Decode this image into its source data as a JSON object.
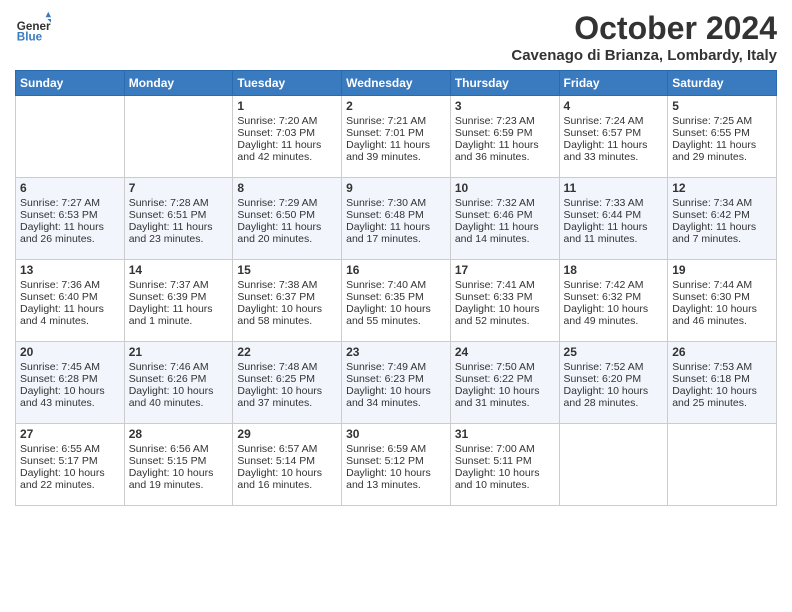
{
  "header": {
    "logo_line1": "General",
    "logo_line2": "Blue",
    "month": "October 2024",
    "location": "Cavenago di Brianza, Lombardy, Italy"
  },
  "weekdays": [
    "Sunday",
    "Monday",
    "Tuesday",
    "Wednesday",
    "Thursday",
    "Friday",
    "Saturday"
  ],
  "weeks": [
    [
      {
        "day": "",
        "empty": true
      },
      {
        "day": "",
        "empty": true
      },
      {
        "day": "1",
        "sunrise": "Sunrise: 7:20 AM",
        "sunset": "Sunset: 7:03 PM",
        "daylight": "Daylight: 11 hours and 42 minutes."
      },
      {
        "day": "2",
        "sunrise": "Sunrise: 7:21 AM",
        "sunset": "Sunset: 7:01 PM",
        "daylight": "Daylight: 11 hours and 39 minutes."
      },
      {
        "day": "3",
        "sunrise": "Sunrise: 7:23 AM",
        "sunset": "Sunset: 6:59 PM",
        "daylight": "Daylight: 11 hours and 36 minutes."
      },
      {
        "day": "4",
        "sunrise": "Sunrise: 7:24 AM",
        "sunset": "Sunset: 6:57 PM",
        "daylight": "Daylight: 11 hours and 33 minutes."
      },
      {
        "day": "5",
        "sunrise": "Sunrise: 7:25 AM",
        "sunset": "Sunset: 6:55 PM",
        "daylight": "Daylight: 11 hours and 29 minutes."
      }
    ],
    [
      {
        "day": "6",
        "sunrise": "Sunrise: 7:27 AM",
        "sunset": "Sunset: 6:53 PM",
        "daylight": "Daylight: 11 hours and 26 minutes."
      },
      {
        "day": "7",
        "sunrise": "Sunrise: 7:28 AM",
        "sunset": "Sunset: 6:51 PM",
        "daylight": "Daylight: 11 hours and 23 minutes."
      },
      {
        "day": "8",
        "sunrise": "Sunrise: 7:29 AM",
        "sunset": "Sunset: 6:50 PM",
        "daylight": "Daylight: 11 hours and 20 minutes."
      },
      {
        "day": "9",
        "sunrise": "Sunrise: 7:30 AM",
        "sunset": "Sunset: 6:48 PM",
        "daylight": "Daylight: 11 hours and 17 minutes."
      },
      {
        "day": "10",
        "sunrise": "Sunrise: 7:32 AM",
        "sunset": "Sunset: 6:46 PM",
        "daylight": "Daylight: 11 hours and 14 minutes."
      },
      {
        "day": "11",
        "sunrise": "Sunrise: 7:33 AM",
        "sunset": "Sunset: 6:44 PM",
        "daylight": "Daylight: 11 hours and 11 minutes."
      },
      {
        "day": "12",
        "sunrise": "Sunrise: 7:34 AM",
        "sunset": "Sunset: 6:42 PM",
        "daylight": "Daylight: 11 hours and 7 minutes."
      }
    ],
    [
      {
        "day": "13",
        "sunrise": "Sunrise: 7:36 AM",
        "sunset": "Sunset: 6:40 PM",
        "daylight": "Daylight: 11 hours and 4 minutes."
      },
      {
        "day": "14",
        "sunrise": "Sunrise: 7:37 AM",
        "sunset": "Sunset: 6:39 PM",
        "daylight": "Daylight: 11 hours and 1 minute."
      },
      {
        "day": "15",
        "sunrise": "Sunrise: 7:38 AM",
        "sunset": "Sunset: 6:37 PM",
        "daylight": "Daylight: 10 hours and 58 minutes."
      },
      {
        "day": "16",
        "sunrise": "Sunrise: 7:40 AM",
        "sunset": "Sunset: 6:35 PM",
        "daylight": "Daylight: 10 hours and 55 minutes."
      },
      {
        "day": "17",
        "sunrise": "Sunrise: 7:41 AM",
        "sunset": "Sunset: 6:33 PM",
        "daylight": "Daylight: 10 hours and 52 minutes."
      },
      {
        "day": "18",
        "sunrise": "Sunrise: 7:42 AM",
        "sunset": "Sunset: 6:32 PM",
        "daylight": "Daylight: 10 hours and 49 minutes."
      },
      {
        "day": "19",
        "sunrise": "Sunrise: 7:44 AM",
        "sunset": "Sunset: 6:30 PM",
        "daylight": "Daylight: 10 hours and 46 minutes."
      }
    ],
    [
      {
        "day": "20",
        "sunrise": "Sunrise: 7:45 AM",
        "sunset": "Sunset: 6:28 PM",
        "daylight": "Daylight: 10 hours and 43 minutes."
      },
      {
        "day": "21",
        "sunrise": "Sunrise: 7:46 AM",
        "sunset": "Sunset: 6:26 PM",
        "daylight": "Daylight: 10 hours and 40 minutes."
      },
      {
        "day": "22",
        "sunrise": "Sunrise: 7:48 AM",
        "sunset": "Sunset: 6:25 PM",
        "daylight": "Daylight: 10 hours and 37 minutes."
      },
      {
        "day": "23",
        "sunrise": "Sunrise: 7:49 AM",
        "sunset": "Sunset: 6:23 PM",
        "daylight": "Daylight: 10 hours and 34 minutes."
      },
      {
        "day": "24",
        "sunrise": "Sunrise: 7:50 AM",
        "sunset": "Sunset: 6:22 PM",
        "daylight": "Daylight: 10 hours and 31 minutes."
      },
      {
        "day": "25",
        "sunrise": "Sunrise: 7:52 AM",
        "sunset": "Sunset: 6:20 PM",
        "daylight": "Daylight: 10 hours and 28 minutes."
      },
      {
        "day": "26",
        "sunrise": "Sunrise: 7:53 AM",
        "sunset": "Sunset: 6:18 PM",
        "daylight": "Daylight: 10 hours and 25 minutes."
      }
    ],
    [
      {
        "day": "27",
        "sunrise": "Sunrise: 6:55 AM",
        "sunset": "Sunset: 5:17 PM",
        "daylight": "Daylight: 10 hours and 22 minutes."
      },
      {
        "day": "28",
        "sunrise": "Sunrise: 6:56 AM",
        "sunset": "Sunset: 5:15 PM",
        "daylight": "Daylight: 10 hours and 19 minutes."
      },
      {
        "day": "29",
        "sunrise": "Sunrise: 6:57 AM",
        "sunset": "Sunset: 5:14 PM",
        "daylight": "Daylight: 10 hours and 16 minutes."
      },
      {
        "day": "30",
        "sunrise": "Sunrise: 6:59 AM",
        "sunset": "Sunset: 5:12 PM",
        "daylight": "Daylight: 10 hours and 13 minutes."
      },
      {
        "day": "31",
        "sunrise": "Sunrise: 7:00 AM",
        "sunset": "Sunset: 5:11 PM",
        "daylight": "Daylight: 10 hours and 10 minutes."
      },
      {
        "day": "",
        "empty": true
      },
      {
        "day": "",
        "empty": true
      }
    ]
  ]
}
